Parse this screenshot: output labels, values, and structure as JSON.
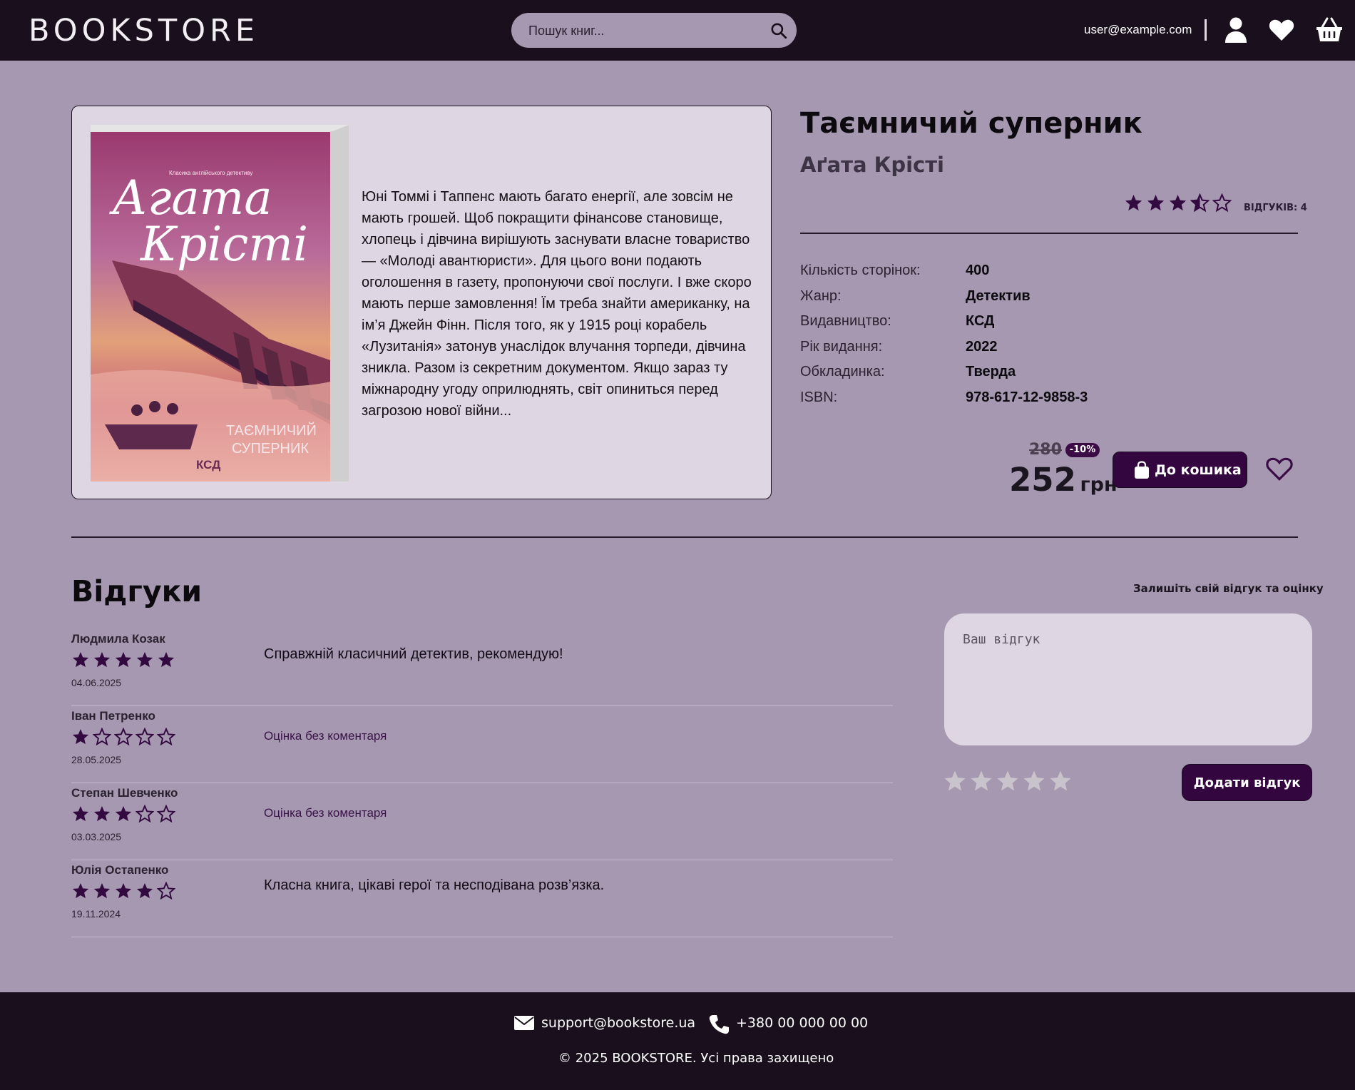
{
  "header": {
    "logo": "BOOKSTORE",
    "search_placeholder": "Пошук книг...",
    "user_email": "user@example.com"
  },
  "book": {
    "title": "Таємничий суперник",
    "author": "Аґата Крісті",
    "rating": 3.5,
    "reviews_label": "ВІДГУКІВ: 4",
    "description": "Юні Томмі і Таппенс мають багато енергії, але зовсім не мають грошей. Щоб покращити фінансове становище, хлопець і дівчина вирішують заснувати власне товариство — «Молоді авантюристи». Для цього вони подають оголошення в газету, пропонуючи свої послуги. І вже скоро мають перше замовлення! Їм треба знайти американку, на ім’я Джейн Фінн. Після того, як у 1915 році корабель «Лузитанія» затонув унаслідок влучання торпеди, дівчина зникла. Разом із секретним документом. Якщо зараз ту міжнародну угоду оприлюднять, світ опиниться перед загрозою нової війни...",
    "cover": {
      "series": "Класика англійського детективу",
      "author_script_1": "Агата",
      "author_script_2": "Крісті",
      "title_1": "ТАЄМНИЧИЙ",
      "title_2": "СУПЕРНИК",
      "publisher": "КСД"
    },
    "properties": [
      {
        "key": "Кількість сторінок:",
        "value": "400"
      },
      {
        "key": "Жанр:",
        "value": "Детектив"
      },
      {
        "key": "Видавництво:",
        "value": "КСД"
      },
      {
        "key": "Рік видання:",
        "value": "2022"
      },
      {
        "key": "Обкладинка:",
        "value": "Тверда"
      },
      {
        "key": "ISBN:",
        "value": "978-617-12-9858-3"
      }
    ],
    "old_price": "280",
    "discount": "-10%",
    "price": "252",
    "currency": "грн",
    "cart_button": "До кошика"
  },
  "reviews": {
    "heading": "Відгуки",
    "items": [
      {
        "name": "Людмила Козак",
        "rating": 5,
        "date": "04.06.2025",
        "text": "Справжній класичний детектив, рекомендую!",
        "muted": false
      },
      {
        "name": "Іван Петренко",
        "rating": 1,
        "date": "28.05.2025",
        "text": "Оцінка без коментаря",
        "muted": true
      },
      {
        "name": "Степан Шевченко",
        "rating": 3,
        "date": "03.03.2025",
        "text": "Оцінка без коментаря",
        "muted": true
      },
      {
        "name": "Юлія Остапенко",
        "rating": 4,
        "date": "19.11.2024",
        "text": "Класна книга, цікаві герої та несподівана розв’язка.",
        "muted": false
      }
    ],
    "leave_label": "Залишіть свій відгук та оцінку",
    "input_placeholder": "Ваш відгук",
    "add_button": "Додати відгук"
  },
  "footer": {
    "email": "support@bookstore.ua",
    "phone": "+380 00 000 00 00",
    "copyright": "© 2025 BOOKSTORE. Усі права захищено"
  },
  "colors": {
    "background": "#a698b1",
    "dark": "#1a101d",
    "accent": "#33063f",
    "card": "#ded6e2",
    "star_filled": "#330a40",
    "star_empty_input": "#c9c4cc"
  },
  "icons": [
    "search-icon",
    "user-icon",
    "heart-icon",
    "basket-icon",
    "bag-icon",
    "mail-icon",
    "phone-icon",
    "star-icon"
  ]
}
